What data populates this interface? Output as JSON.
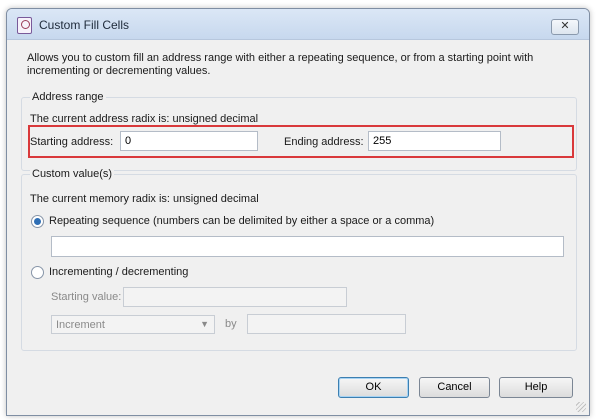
{
  "window": {
    "title": "Custom Fill Cells",
    "close_label": "✕",
    "description": "Allows you to custom fill an address range with either a repeating sequence, or from a starting point with incrementing or decrementing values."
  },
  "address_range": {
    "group_label": "Address range",
    "radix_text": "The current address radix is: unsigned decimal",
    "starting_label": "Starting address:",
    "starting_value": "0",
    "ending_label": "Ending address:",
    "ending_value": "255"
  },
  "custom_values": {
    "group_label": "Custom value(s)",
    "radix_text": "The current memory radix is: unsigned decimal",
    "repeating_label": "Repeating sequence (numbers can be delimited by either a space or a comma)",
    "repeating_selected": true,
    "repeating_value": "",
    "incrementing_label": "Incrementing / decrementing",
    "incrementing_selected": false,
    "starting_value_label": "Starting value:",
    "starting_value": "",
    "mode_selected": "Increment",
    "by_label": "by",
    "by_value": ""
  },
  "buttons": {
    "ok": "OK",
    "cancel": "Cancel",
    "help": "Help"
  },
  "colors": {
    "highlight": "#d9393b",
    "titlebar": "#c7d8ee",
    "radio_selected": "#2f6fb5"
  }
}
